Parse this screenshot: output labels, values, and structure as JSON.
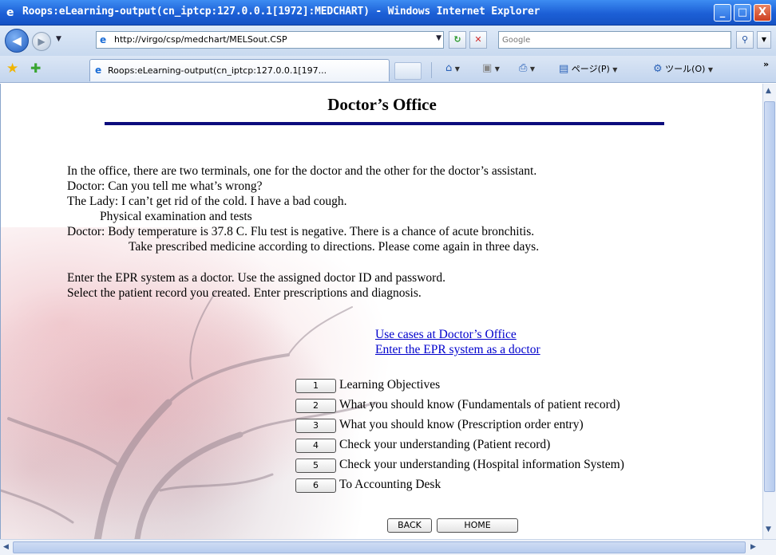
{
  "window": {
    "title": "Roops:eLearning-output(cn_iptcp:127.0.0.1[1972]:MEDCHART) - Windows Internet Explorer",
    "minimize": "_",
    "maximize": "□",
    "close": "X"
  },
  "address": {
    "url": "http://virgo/csp/medchart/MELSout.CSP",
    "search_placeholder": "Google"
  },
  "tabs": [
    {
      "label": "Roops:eLearning-output(cn_iptcp:127.0.0.1[197..."
    }
  ],
  "commands": {
    "page": "ページ(P)",
    "tools": "ツール(O)",
    "more": "»"
  },
  "page": {
    "title": "Doctor’s Office",
    "lines": [
      "In the office, there are two terminals, one for the doctor and the other for the doctor’s assistant.",
      "Doctor: Can you tell me what’s wrong?",
      "The Lady: I can’t get rid of the cold.  I have a bad cough.",
      "Physical examination and tests",
      "Doctor: Body temperature is 37.8 C.  Flu test is negative.  There is a chance of acute bronchitis.",
      "Take prescribed medicine according to directions.  Please come again in three days.",
      "Enter the EPR system as a doctor.  Use the assigned doctor ID and password.",
      "Select the patient record you created. Enter prescriptions and diagnosis."
    ],
    "links": [
      "Use cases at Doctor’s Office",
      "Enter the EPR system as a doctor"
    ],
    "menu": [
      {
        "num": "1",
        "label": "Learning Objectives"
      },
      {
        "num": "2",
        "label": "What you should know (Fundamentals of patient record)"
      },
      {
        "num": "3",
        "label": "What you should know (Prescription order entry)"
      },
      {
        "num": "4",
        "label": "Check your understanding (Patient record)"
      },
      {
        "num": "5",
        "label": "Check your understanding (Hospital information System)"
      },
      {
        "num": "6",
        "label": "To Accounting Desk"
      }
    ],
    "back_label": "BACK",
    "home_label": "HOME"
  },
  "colors": {
    "link": "#0000cc",
    "rule": "#0c0c7d",
    "titlebar": "#1c5fd6"
  }
}
